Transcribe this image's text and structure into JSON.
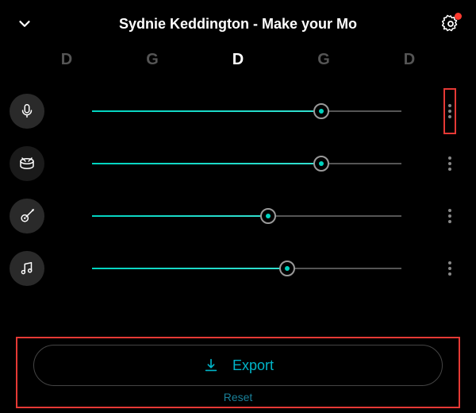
{
  "header": {
    "title": "Sydnie Keddington - Make your Mo"
  },
  "chords": [
    {
      "label": "D",
      "active": false
    },
    {
      "label": "G",
      "active": false
    },
    {
      "label": "D",
      "active": true
    },
    {
      "label": "G",
      "active": false
    },
    {
      "label": "D",
      "active": false
    }
  ],
  "tracks": [
    {
      "icon": "mic-icon",
      "value": 74,
      "menu_highlight": true
    },
    {
      "icon": "drums-icon",
      "value": 74,
      "menu_highlight": false
    },
    {
      "icon": "guitar-icon",
      "value": 57,
      "menu_highlight": false
    },
    {
      "icon": "music-icon",
      "value": 63,
      "menu_highlight": false
    }
  ],
  "footer": {
    "export_label": "Export",
    "reset_label": "Reset"
  },
  "colors": {
    "accent": "#00d4c0",
    "highlight": "#e53935"
  }
}
